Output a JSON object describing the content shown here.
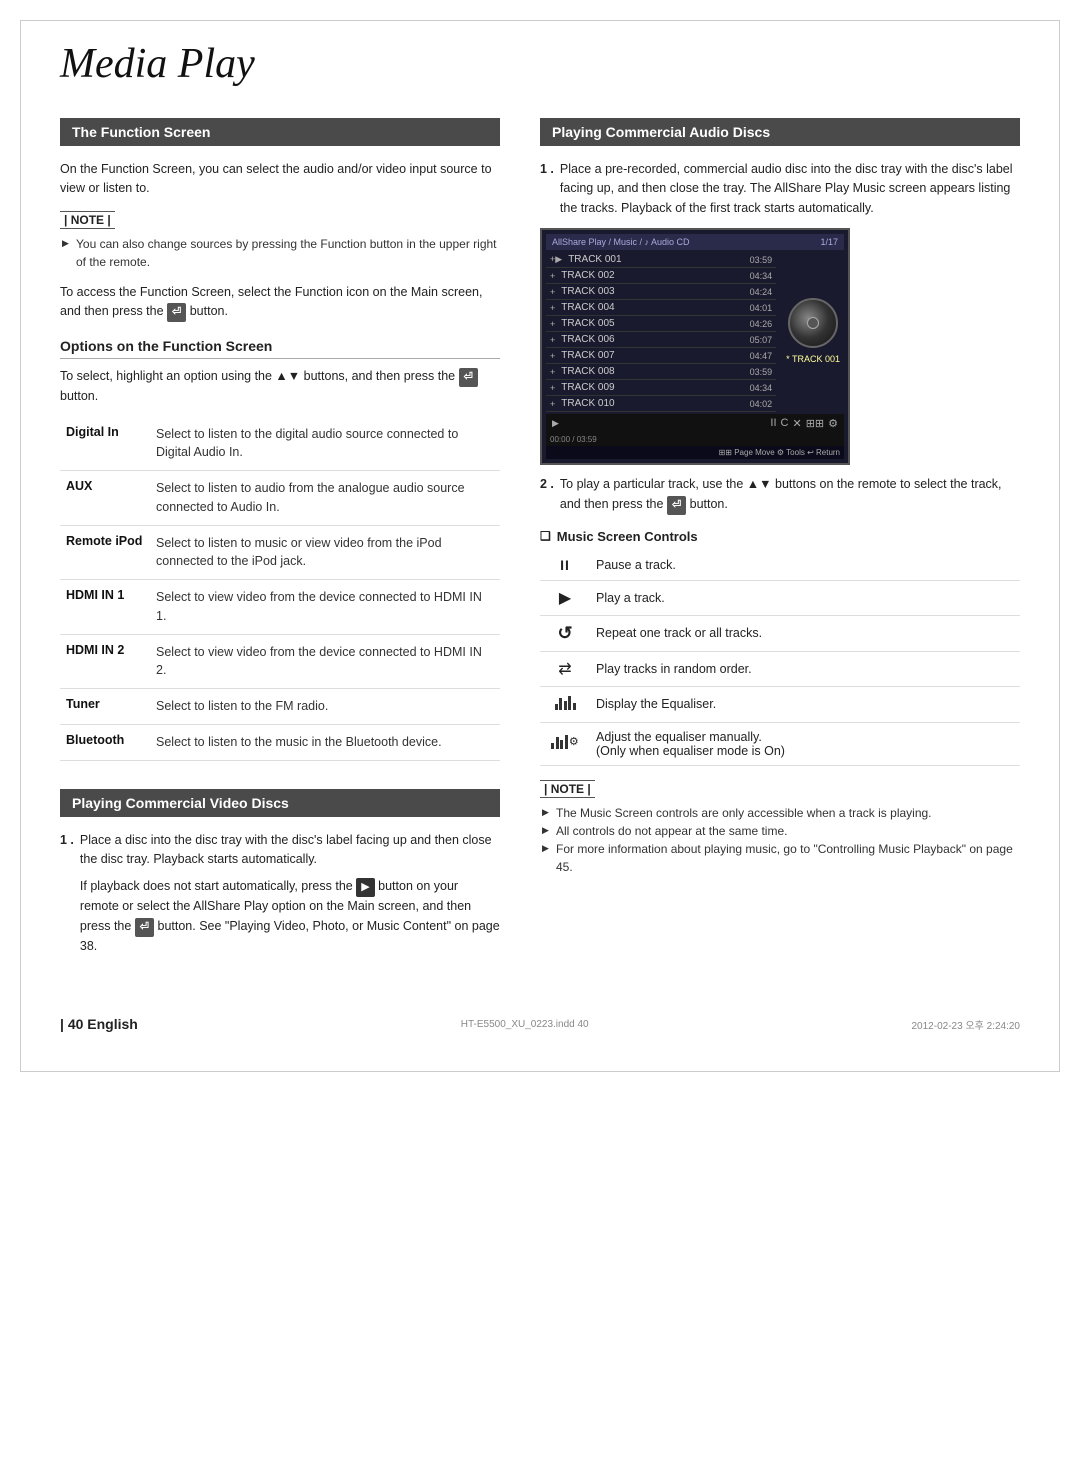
{
  "page": {
    "title": "Media Play",
    "page_number": "| 40",
    "language": "English",
    "footer_file": "HT-E5500_XU_0223.indd  40",
    "footer_date": "2012-02-23  오후 2:24:20"
  },
  "left_col": {
    "function_screen": {
      "header": "The Function Screen",
      "intro": "On the Function Screen, you can select the audio and/or video input source to view or listen to.",
      "note_label": "| NOTE |",
      "note_items": [
        "You can also change sources by pressing the Function button in the upper right of the remote."
      ],
      "access_text": "To access the Function Screen, select the Function icon on the Main screen, and then press the  button.",
      "options_heading": "Options on the Function Screen",
      "options_intro": "To select, highlight an option using the ▲▼ buttons, and then press the  button.",
      "table_rows": [
        {
          "label": "Digital In",
          "description": "Select to listen to the digital audio source connected to Digital Audio In."
        },
        {
          "label": "AUX",
          "description": "Select to listen to audio from the analogue audio source connected to Audio In."
        },
        {
          "label": "Remote iPod",
          "description": "Select to listen to music or view video from the iPod connected to the iPod jack."
        },
        {
          "label": "HDMI IN 1",
          "description": "Select to view video from the device connected to HDMI IN 1."
        },
        {
          "label": "HDMI IN 2",
          "description": "Select to view video from the device connected to HDMI IN 2."
        },
        {
          "label": "Tuner",
          "description": "Select to listen to the FM radio."
        },
        {
          "label": "Bluetooth",
          "description": "Select to listen to the music in the Bluetooth device."
        }
      ]
    },
    "video_discs": {
      "header": "Playing Commercial Video Discs",
      "step1_text": "Place a disc into the disc tray with the disc's label facing up and then close the disc tray. Playback starts automatically.",
      "step1_cont": "If playback does not start automatically, press the  button on your remote or select the AllShare Play option on the Main screen, and then press the  button. See \"Playing Video, Photo, or Music Content\" on page 38."
    }
  },
  "right_col": {
    "audio_discs": {
      "header": "Playing Commercial Audio Discs",
      "step1_text": "Place a pre-recorded, commercial audio disc into the disc tray with the disc's label facing up, and then close the tray. The AllShare Play Music screen appears listing the tracks. Playback of the first track starts automatically.",
      "allshare_screen": {
        "header_left": "AllShare Play / Music /  Audio CD",
        "header_right": "1/17",
        "tracks": [
          {
            "label": "TRACK 001",
            "time": "03:59",
            "selected": false
          },
          {
            "label": "TRACK 002",
            "time": "04:34",
            "selected": false
          },
          {
            "label": "TRACK 003",
            "time": "04:24",
            "selected": false
          },
          {
            "label": "TRACK 004",
            "time": "04:01",
            "selected": false
          },
          {
            "label": "TRACK 005",
            "time": "04:26",
            "selected": false
          },
          {
            "label": "TRACK 006",
            "time": "05:07",
            "selected": false
          },
          {
            "label": "TRACK 007",
            "time": "04:47",
            "selected": false
          },
          {
            "label": "TRACK 008",
            "time": "03:59",
            "selected": false
          },
          {
            "label": "TRACK 009",
            "time": "04:34",
            "selected": false
          },
          {
            "label": "TRACK 010",
            "time": "04:02",
            "selected": false
          }
        ],
        "track_info": "* TRACK 001",
        "progress": "00:00 / 03:59",
        "nav_text": "Page Move  Tools  Return"
      },
      "step2_text": "To play a particular track, use the ▲▼ buttons on the remote to select the track, and then press the  button."
    },
    "music_controls": {
      "heading": "Music Screen Controls",
      "controls": [
        {
          "symbol": "II",
          "description": "Pause a track."
        },
        {
          "symbol": "▶",
          "description": "Play a track."
        },
        {
          "symbol": "↺",
          "description": "Repeat one track or all tracks."
        },
        {
          "symbol": "⇄",
          "description": "Play tracks in random order."
        },
        {
          "symbol": "EQ_BARS",
          "description": "Display the Equaliser."
        },
        {
          "symbol": "EQ_GEAR",
          "description": "Adjust the equaliser manually.\n(Only when equaliser mode is On)"
        }
      ],
      "note_label": "| NOTE |",
      "note_items": [
        "The Music Screen controls are only accessible when a track is playing.",
        "All controls do not appear at the same time.",
        "For more information about playing music, go to \"Controlling Music Playback\" on page 45."
      ]
    }
  }
}
